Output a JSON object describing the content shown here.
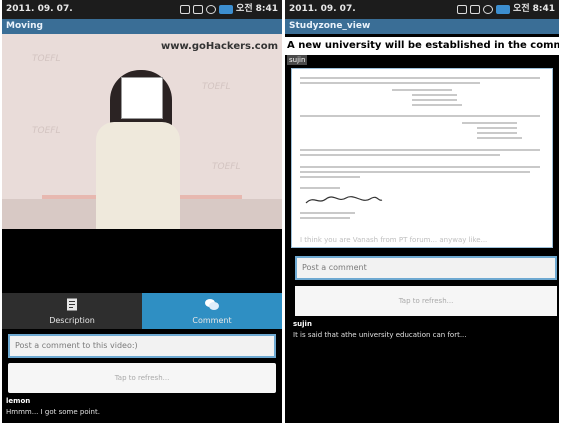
{
  "left_phone": {
    "status": {
      "date": "2011. 09. 07.",
      "ampm": "오전",
      "time": "8:41"
    },
    "title": "Moving",
    "video": {
      "site": "www.goHackers.com",
      "watermark": "TOEFL"
    },
    "tabs": [
      {
        "label": "Description",
        "icon": "document-icon"
      },
      {
        "label": "Comment",
        "icon": "chat-bubbles-icon"
      }
    ],
    "comment_placeholder": "Post a comment to this video:)",
    "refresh_label": "Tap to refresh...",
    "latest_comment": {
      "user": "lemon",
      "text": "Hmmm... I got some point."
    }
  },
  "right_phone": {
    "status": {
      "date": "2011. 09. 07.",
      "ampm": "오전",
      "time": "8:41"
    },
    "title": "Studyzone_view",
    "headline": "A new university will be established in the commun...",
    "author": "sujin",
    "doc_faint_text": "I think you are Vanash from PT forum... anyway like...",
    "comment_placeholder": "Post a comment",
    "refresh_label": "Tap to refresh...",
    "latest_comment": {
      "user": "sujin",
      "text": "It is said that athe university education can fort..."
    }
  },
  "colors": {
    "titlebar": "#3a6e96",
    "active_tab": "#2f8fc3",
    "input_border": "#6ea9d1"
  }
}
